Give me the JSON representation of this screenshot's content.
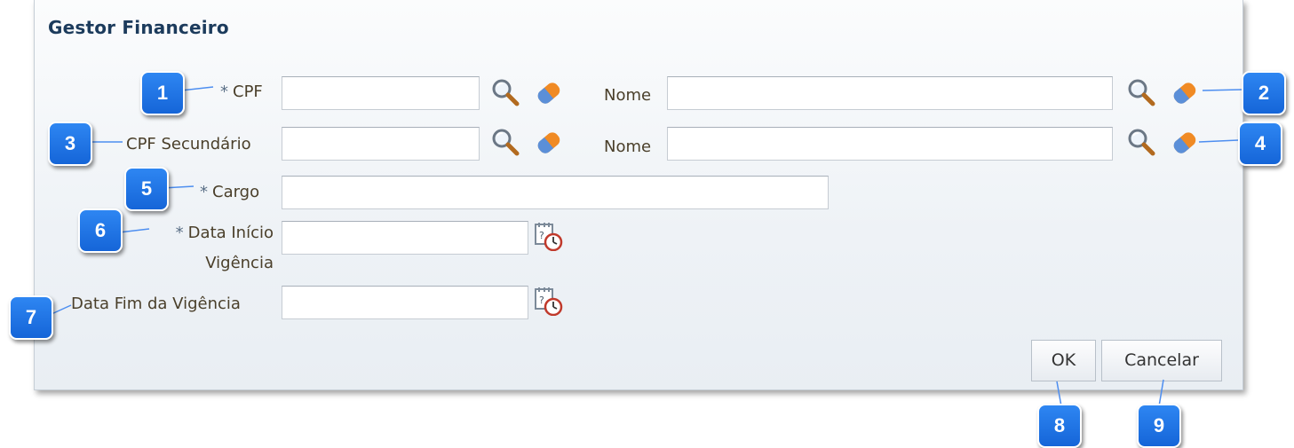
{
  "dialog": {
    "title": "Gestor Financeiro",
    "fields": {
      "cpf": {
        "required_mark": "*",
        "label": "CPF",
        "value": ""
      },
      "cpf_nome": {
        "label": "Nome",
        "value": ""
      },
      "cpf_secundario": {
        "label": "CPF Secundário",
        "value": ""
      },
      "cpf_secundario_nome": {
        "label": "Nome",
        "value": ""
      },
      "cargo": {
        "required_mark": "*",
        "label": "Cargo",
        "value": ""
      },
      "data_inicio": {
        "required_mark": "*",
        "label_line1": "Data Início",
        "label_line2": "Vigência",
        "value": ""
      },
      "data_fim": {
        "label": "Data Fim da Vigência",
        "value": ""
      }
    },
    "buttons": {
      "ok": "OK",
      "cancel": "Cancelar"
    }
  },
  "callouts": [
    "1",
    "2",
    "3",
    "4",
    "5",
    "6",
    "7",
    "8",
    "9"
  ],
  "colors": {
    "badge": "#1e74e6",
    "title": "#1c3b5c",
    "label": "#4a3f2a",
    "eraser": "#f08a24"
  }
}
